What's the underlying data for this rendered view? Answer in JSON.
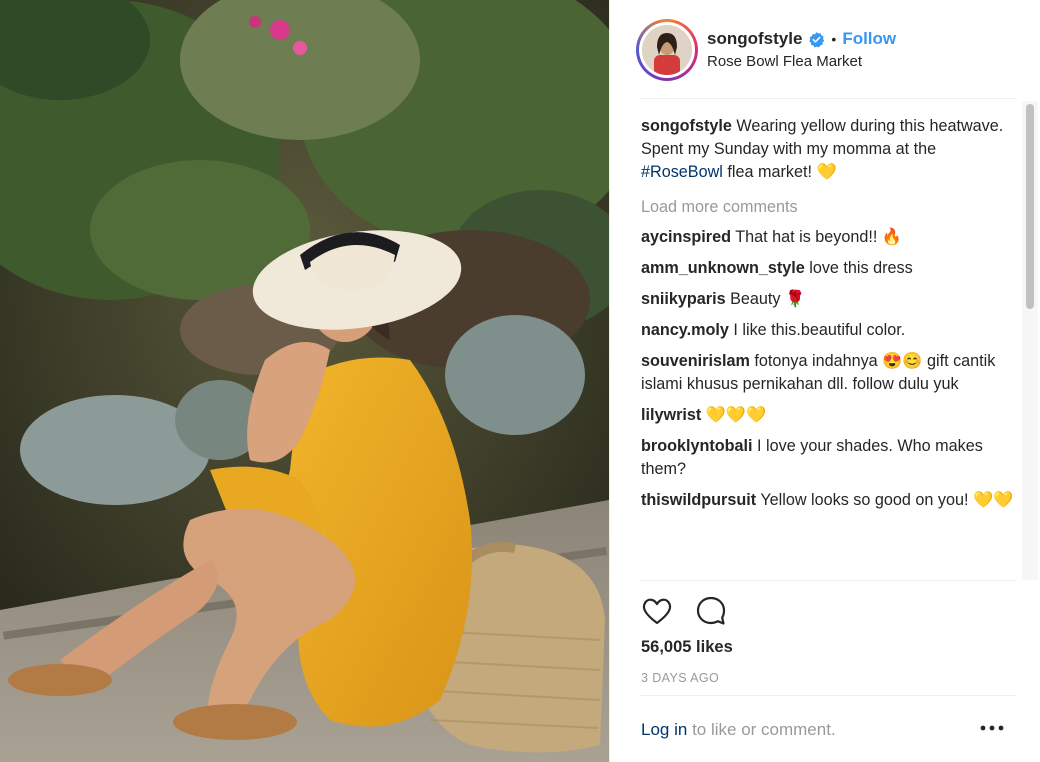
{
  "header": {
    "username": "songofstyle",
    "separator": "•",
    "follow_label": "Follow",
    "location": "Rose Bowl Flea Market"
  },
  "caption": {
    "author": "songofstyle",
    "text_before": "Wearing yellow during this heatwave. Spent my Sunday with my momma at the",
    "hashtag": "#RoseBowl",
    "text_after": "flea market! 💛"
  },
  "load_more": "Load more comments",
  "comments": [
    {
      "author": "aycinspired",
      "text": "That hat is beyond!! 🔥"
    },
    {
      "author": "amm_unknown_style",
      "text": "love this dress"
    },
    {
      "author": "sniikyparis",
      "text": "Beauty 🌹"
    },
    {
      "author": "nancy.moly",
      "text": "I like this.beautiful color."
    },
    {
      "author": "souvenirislam",
      "text": "fotonya indahnya 😍😊 gift cantik islami khusus pernikahan dll. follow dulu yuk"
    },
    {
      "author": "lilywrist",
      "text": "💛💛💛"
    },
    {
      "author": "brooklyntobali",
      "text": "I love your shades. Who makes them?"
    },
    {
      "author": "thiswildpursuit",
      "text": "Yellow looks so good on you! 💛💛"
    }
  ],
  "likes": "56,005 likes",
  "timestamp": "3 DAYS AGO",
  "footer": {
    "login_label": "Log in",
    "login_rest": "to like or comment."
  },
  "icons": {
    "verified": "verified-badge-icon",
    "like": "heart-icon",
    "comment": "comment-bubble-icon",
    "more": "more-options-icon"
  },
  "colors": {
    "link_blue": "#3897f0",
    "hashtag": "#003569",
    "muted": "#999999",
    "text": "#262626"
  }
}
